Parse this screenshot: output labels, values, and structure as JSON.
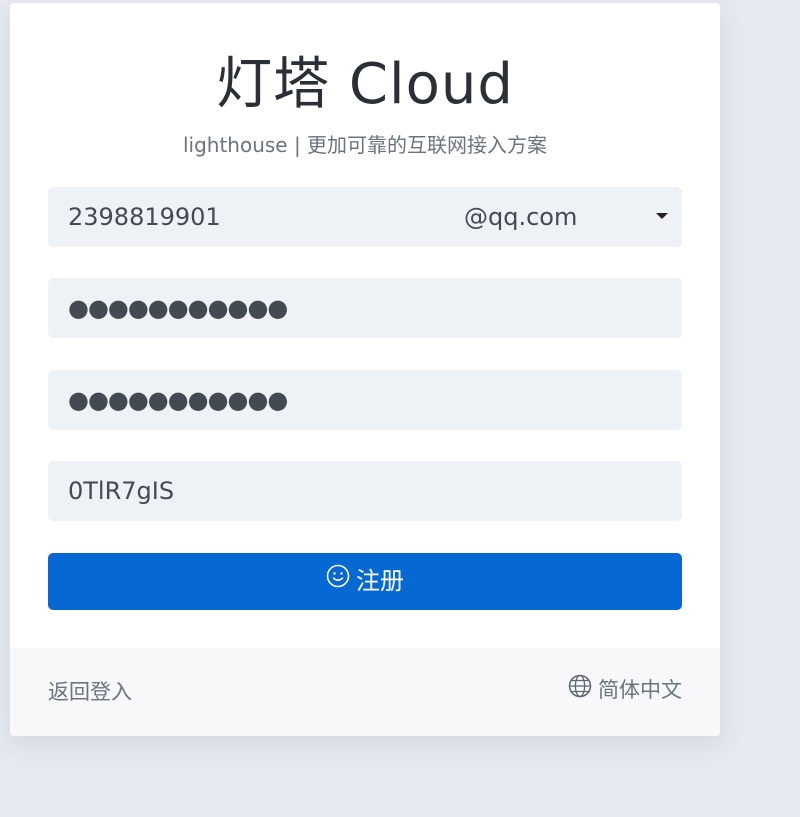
{
  "brand": {
    "title": "灯塔 Cloud",
    "subtitle": "lighthouse | 更加可靠的互联网接入方案"
  },
  "form": {
    "email_local": "2398819901",
    "email_domain": "@qq.com",
    "password_mask": "●●●●●●●●●●●",
    "confirm_password_mask": "●●●●●●●●●●●",
    "captcha_value": "0TlR7gIS",
    "submit_label": "注册",
    "submit_icon": "smile-icon"
  },
  "footer": {
    "back_login_label": "返回登入",
    "language_label": "简体中文",
    "language_icon": "globe-icon"
  },
  "colors": {
    "background": "#e6e9f1",
    "card": "#ffffff",
    "field": "#eef1f6",
    "primary": "#0668d3",
    "footer": "#f7f8fa"
  }
}
